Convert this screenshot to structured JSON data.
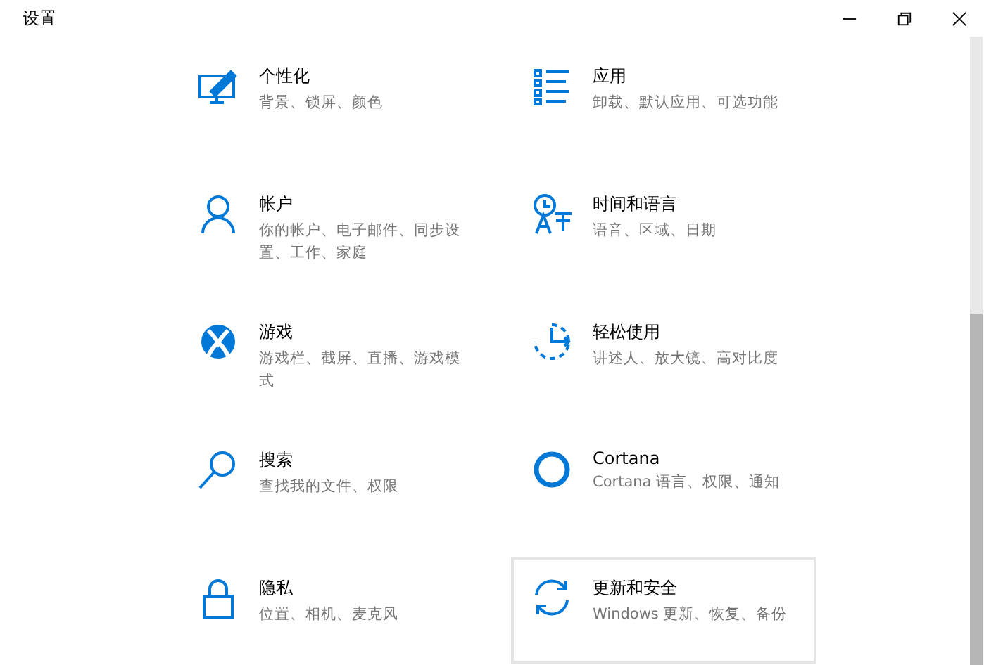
{
  "window": {
    "title": "设置"
  },
  "tiles": [
    {
      "title": "个性化",
      "subtitle": "背景、锁屏、颜色",
      "hovered": false
    },
    {
      "title": "应用",
      "subtitle": "卸载、默认应用、可选功能",
      "hovered": false
    },
    {
      "title": "帐户",
      "subtitle": "你的帐户、电子邮件、同步设置、工作、家庭",
      "hovered": false
    },
    {
      "title": "时间和语言",
      "subtitle": "语音、区域、日期",
      "hovered": false
    },
    {
      "title": "游戏",
      "subtitle": "游戏栏、截屏、直播、游戏模式",
      "hovered": false
    },
    {
      "title": "轻松使用",
      "subtitle": "讲述人、放大镜、高对比度",
      "hovered": false
    },
    {
      "title": "搜索",
      "subtitle": "查找我的文件、权限",
      "hovered": false
    },
    {
      "title": "Cortana",
      "subtitle": "Cortana 语言、权限、通知",
      "hovered": false
    },
    {
      "title": "隐私",
      "subtitle": "位置、相机、麦克风",
      "hovered": false
    },
    {
      "title": "更新和安全",
      "subtitle": "Windows 更新、恢复、备份",
      "hovered": true
    }
  ]
}
